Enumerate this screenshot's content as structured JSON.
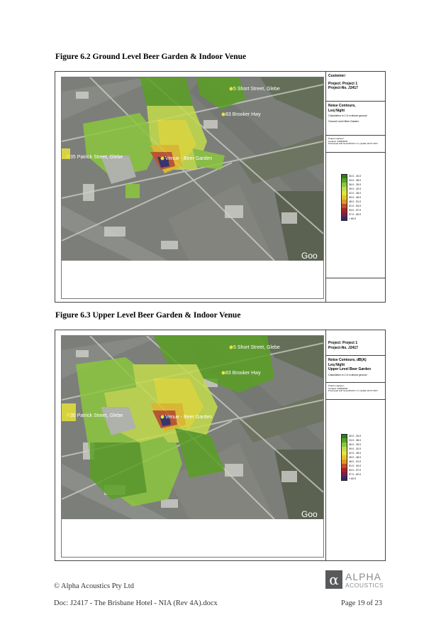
{
  "figures": [
    {
      "title": "Figure 6.2 Ground Level Beer Garden & Indoor Venue",
      "panel": {
        "customer_label": "Customer:",
        "project": "Project: Project 1",
        "project_no": "Project-No. J2417",
        "result_title_1": "Noise Contours,",
        "result_title_2": "Leq Night",
        "result_title_3": "",
        "calc_note": "Calculation in 1.5 m above ground",
        "scenario_note": "Ground Level Beer Garden",
        "engineer": "Project engineer:",
        "created": "Created: 14/08/2020",
        "processed": "Processed with SoundPLAN 7.4, Update 18.07.2017"
      },
      "map_labels": {
        "short_street": "5 Short Street, Glebe",
        "brooker": "83 Brooker Hwy",
        "patrick": "35 Patrick Street, Glebe",
        "venue": "Venue - Beer Garden"
      },
      "google": "Goo"
    },
    {
      "title": "Figure 6.3 Upper Level Beer Garden & Indoor Venue",
      "panel": {
        "customer_label": "",
        "project": "Project: Project 1",
        "project_no": "Project-No. J2417",
        "result_title_1": "Noise Contours, dB(A)",
        "result_title_2": "Leq Night",
        "result_title_3": "Upper Level Beer Garden",
        "calc_note": "Calculation in 1.5 m above ground",
        "scenario_note": "",
        "engineer": "Project engineer:",
        "created": "Created: 14/08/2020",
        "processed": "Processed with SoundPLAN 7.4, Update 18.07.2017"
      },
      "map_labels": {
        "short_street": "5 Short Street, Glebe",
        "brooker": "83 Brooker Hwy",
        "patrick": "35 Patrick Street, Glebe",
        "venue": "Venue - Beer Garden"
      },
      "google": "Goo"
    }
  ],
  "legend": [
    {
      "label": "30.0  -   33.0",
      "color": "#2e7d1f"
    },
    {
      "label": "33.0  -   36.0",
      "color": "#5aa024"
    },
    {
      "label": "36.0  -   39.0",
      "color": "#8cc63f"
    },
    {
      "label": "39.0  -   42.0",
      "color": "#c3dc4c"
    },
    {
      "label": "42.0  -   45.0",
      "color": "#e6e23a"
    },
    {
      "label": "45.0  -   48.0",
      "color": "#e8c12a"
    },
    {
      "label": "48.0  -   51.0",
      "color": "#d99a2b"
    },
    {
      "label": "51.0  -   54.0",
      "color": "#c2502a"
    },
    {
      "label": "54.0  -   57.0",
      "color": "#a82424"
    },
    {
      "label": "57.0  -   60.0",
      "color": "#7a1f4a"
    },
    {
      "label": ">    60.0",
      "color": "#2b2a6b"
    }
  ],
  "footer": {
    "copyright": "© Alpha Acoustics Pty Ltd",
    "doc": "Doc: J2417 - The Brisbane Hotel - NIA (Rev 4A).docx",
    "page": "Page 19 of 23"
  },
  "logo": {
    "symbol": "α",
    "line1": "ALPHA",
    "line2": "ACOUSTICS"
  }
}
